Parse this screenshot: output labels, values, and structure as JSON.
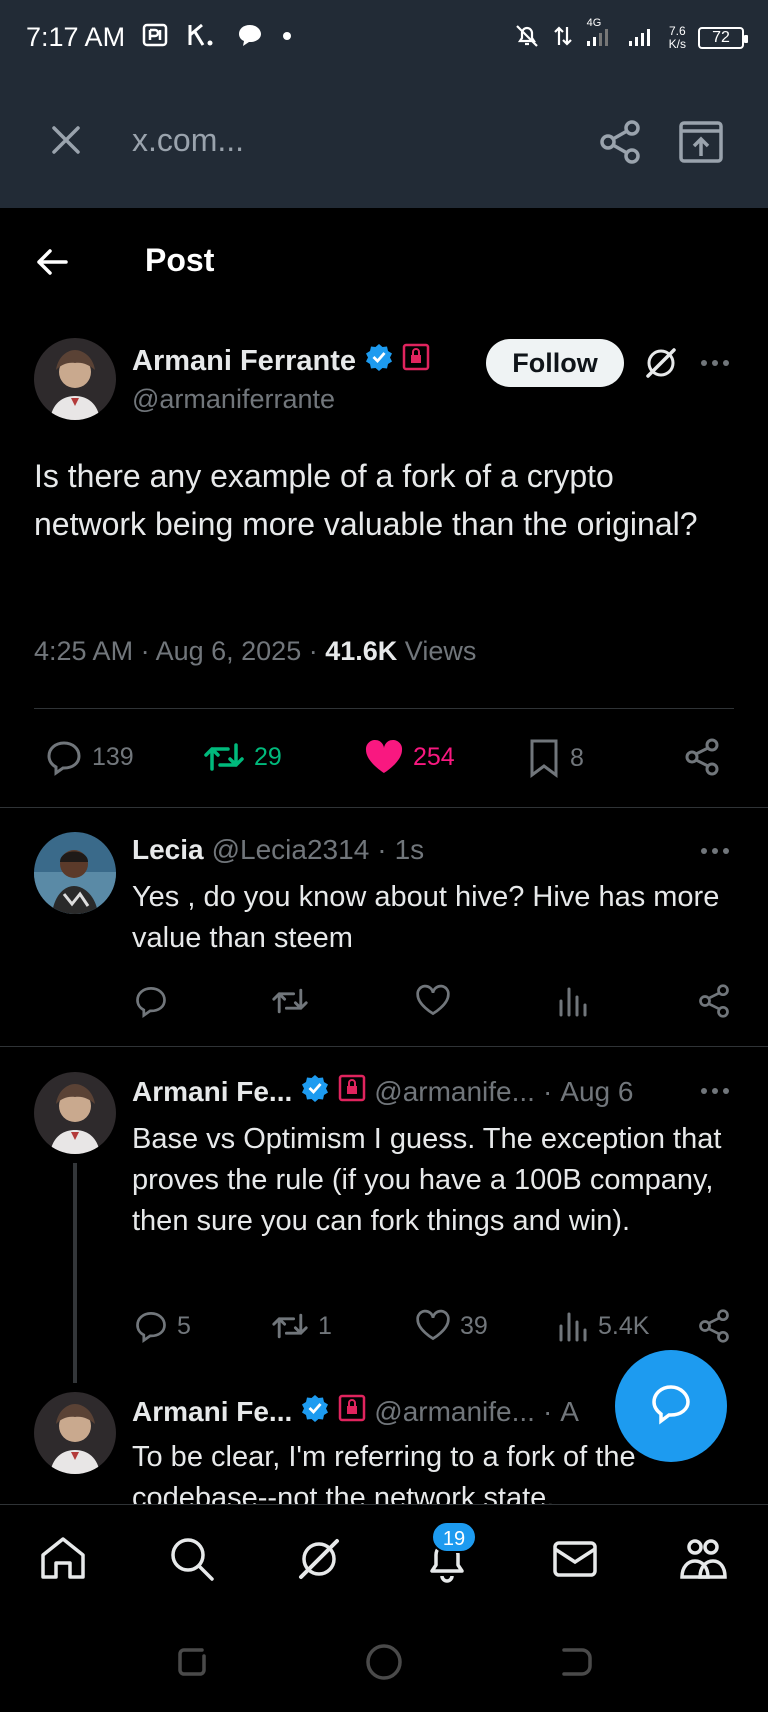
{
  "status_bar": {
    "time": "7:17 AM",
    "network": "4G",
    "speed_value": "7.6",
    "speed_unit": "K/s",
    "battery": "72"
  },
  "browser": {
    "url": "x.com..."
  },
  "header": {
    "title": "Post"
  },
  "post": {
    "author_name": "Armani Ferrante",
    "author_handle": "@armaniferrante",
    "follow_label": "Follow",
    "text": "Is there any example of a fork of a crypto network being more valuable than the original?",
    "time": "4:25 AM",
    "date": "Aug 6, 2025",
    "views_count": "41.6K",
    "views_label": "Views",
    "replies": "139",
    "reposts": "29",
    "likes": "254",
    "bookmarks": "8",
    "repost_color": "#00ba7c",
    "like_color": "#f91880"
  },
  "replies": [
    {
      "name": "Lecia",
      "handle": "@Lecia2314",
      "time": "1s",
      "text": "Yes , do you know about hive? Hive has more value than steem"
    },
    {
      "name": "Armani Fe...",
      "handle": "@armanife...",
      "time": "Aug 6",
      "text": "Base vs Optimism I guess. The exception that proves the rule (if you have a 100B company, then sure you can fork things and win).",
      "replies": "5",
      "reposts": "1",
      "likes": "39",
      "views": "5.4K"
    },
    {
      "name": "Armani Fe...",
      "handle": "@armanife...",
      "time_partial": "A",
      "text": "To be clear, I'm referring to a fork of the codebase--not the network state."
    }
  ],
  "bottom_nav": {
    "notifications_badge": "19"
  },
  "colors": {
    "accent": "#1d9bf0",
    "verified": "#1d9bf0",
    "background": "#000000",
    "browser_bar": "#222b36"
  }
}
